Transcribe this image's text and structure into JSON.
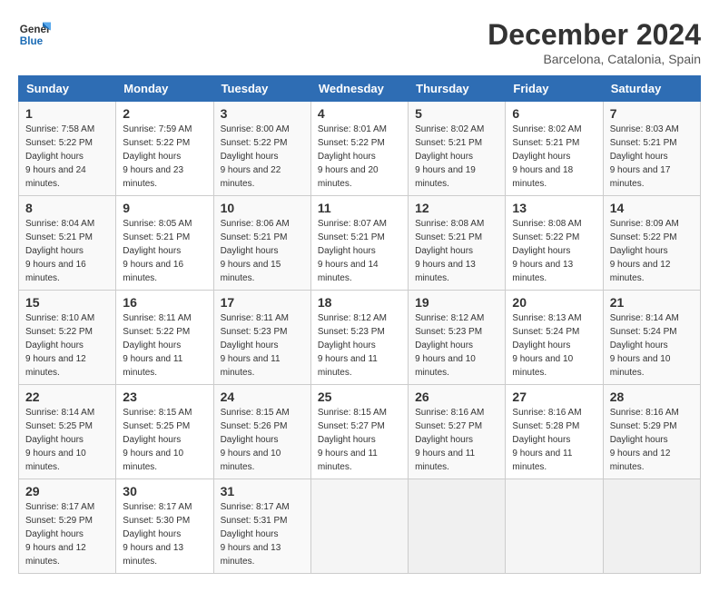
{
  "logo": {
    "line1": "General",
    "line2": "Blue"
  },
  "title": "December 2024",
  "location": "Barcelona, Catalonia, Spain",
  "days_of_week": [
    "Sunday",
    "Monday",
    "Tuesday",
    "Wednesday",
    "Thursday",
    "Friday",
    "Saturday"
  ],
  "weeks": [
    [
      {
        "num": "1",
        "rise": "7:58 AM",
        "set": "5:22 PM",
        "daylight": "9 hours and 24 minutes."
      },
      {
        "num": "2",
        "rise": "7:59 AM",
        "set": "5:22 PM",
        "daylight": "9 hours and 23 minutes."
      },
      {
        "num": "3",
        "rise": "8:00 AM",
        "set": "5:22 PM",
        "daylight": "9 hours and 22 minutes."
      },
      {
        "num": "4",
        "rise": "8:01 AM",
        "set": "5:22 PM",
        "daylight": "9 hours and 20 minutes."
      },
      {
        "num": "5",
        "rise": "8:02 AM",
        "set": "5:21 PM",
        "daylight": "9 hours and 19 minutes."
      },
      {
        "num": "6",
        "rise": "8:02 AM",
        "set": "5:21 PM",
        "daylight": "9 hours and 18 minutes."
      },
      {
        "num": "7",
        "rise": "8:03 AM",
        "set": "5:21 PM",
        "daylight": "9 hours and 17 minutes."
      }
    ],
    [
      {
        "num": "8",
        "rise": "8:04 AM",
        "set": "5:21 PM",
        "daylight": "9 hours and 16 minutes."
      },
      {
        "num": "9",
        "rise": "8:05 AM",
        "set": "5:21 PM",
        "daylight": "9 hours and 16 minutes."
      },
      {
        "num": "10",
        "rise": "8:06 AM",
        "set": "5:21 PM",
        "daylight": "9 hours and 15 minutes."
      },
      {
        "num": "11",
        "rise": "8:07 AM",
        "set": "5:21 PM",
        "daylight": "9 hours and 14 minutes."
      },
      {
        "num": "12",
        "rise": "8:08 AM",
        "set": "5:21 PM",
        "daylight": "9 hours and 13 minutes."
      },
      {
        "num": "13",
        "rise": "8:08 AM",
        "set": "5:22 PM",
        "daylight": "9 hours and 13 minutes."
      },
      {
        "num": "14",
        "rise": "8:09 AM",
        "set": "5:22 PM",
        "daylight": "9 hours and 12 minutes."
      }
    ],
    [
      {
        "num": "15",
        "rise": "8:10 AM",
        "set": "5:22 PM",
        "daylight": "9 hours and 12 minutes."
      },
      {
        "num": "16",
        "rise": "8:11 AM",
        "set": "5:22 PM",
        "daylight": "9 hours and 11 minutes."
      },
      {
        "num": "17",
        "rise": "8:11 AM",
        "set": "5:23 PM",
        "daylight": "9 hours and 11 minutes."
      },
      {
        "num": "18",
        "rise": "8:12 AM",
        "set": "5:23 PM",
        "daylight": "9 hours and 11 minutes."
      },
      {
        "num": "19",
        "rise": "8:12 AM",
        "set": "5:23 PM",
        "daylight": "9 hours and 10 minutes."
      },
      {
        "num": "20",
        "rise": "8:13 AM",
        "set": "5:24 PM",
        "daylight": "9 hours and 10 minutes."
      },
      {
        "num": "21",
        "rise": "8:14 AM",
        "set": "5:24 PM",
        "daylight": "9 hours and 10 minutes."
      }
    ],
    [
      {
        "num": "22",
        "rise": "8:14 AM",
        "set": "5:25 PM",
        "daylight": "9 hours and 10 minutes."
      },
      {
        "num": "23",
        "rise": "8:15 AM",
        "set": "5:25 PM",
        "daylight": "9 hours and 10 minutes."
      },
      {
        "num": "24",
        "rise": "8:15 AM",
        "set": "5:26 PM",
        "daylight": "9 hours and 10 minutes."
      },
      {
        "num": "25",
        "rise": "8:15 AM",
        "set": "5:27 PM",
        "daylight": "9 hours and 11 minutes."
      },
      {
        "num": "26",
        "rise": "8:16 AM",
        "set": "5:27 PM",
        "daylight": "9 hours and 11 minutes."
      },
      {
        "num": "27",
        "rise": "8:16 AM",
        "set": "5:28 PM",
        "daylight": "9 hours and 11 minutes."
      },
      {
        "num": "28",
        "rise": "8:16 AM",
        "set": "5:29 PM",
        "daylight": "9 hours and 12 minutes."
      }
    ],
    [
      {
        "num": "29",
        "rise": "8:17 AM",
        "set": "5:29 PM",
        "daylight": "9 hours and 12 minutes."
      },
      {
        "num": "30",
        "rise": "8:17 AM",
        "set": "5:30 PM",
        "daylight": "9 hours and 13 minutes."
      },
      {
        "num": "31",
        "rise": "8:17 AM",
        "set": "5:31 PM",
        "daylight": "9 hours and 13 minutes."
      },
      null,
      null,
      null,
      null
    ]
  ]
}
